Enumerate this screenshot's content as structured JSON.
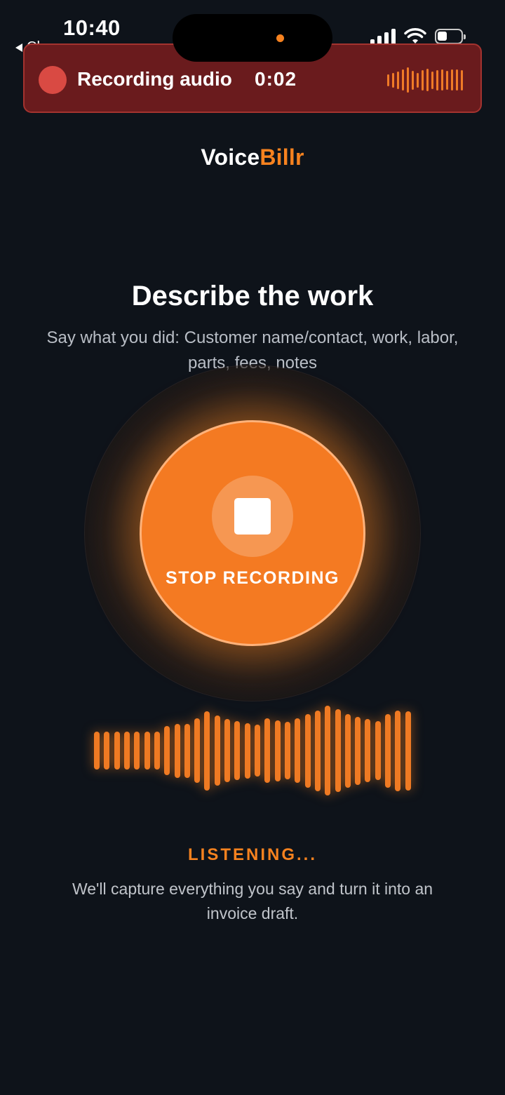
{
  "status_bar": {
    "time": "10:40",
    "back_app": "Chrome"
  },
  "recording_banner": {
    "label": "Recording audio",
    "timer": "0:02"
  },
  "brand": {
    "part1": "Voice",
    "part2": "Billr",
    "accent_color": "#f6821f"
  },
  "main": {
    "title": "Describe the work",
    "subtitle": "Say what you did: Customer name/contact, work, labor, parts, fees, notes",
    "record_button_label": "STOP RECORDING",
    "status": "LISTENING...",
    "description": "We'll capture everything you say and turn it into an invoice draft."
  },
  "icons": {
    "stop": "stop-icon",
    "record_indicator": "record-dot-icon",
    "signal": "cellular-signal-icon",
    "wifi": "wifi-icon",
    "battery": "battery-icon",
    "back": "back-arrow-icon"
  },
  "waveform_levels": [
    0.42,
    0.42,
    0.42,
    0.42,
    0.42,
    0.42,
    0.42,
    0.55,
    0.6,
    0.6,
    0.72,
    0.88,
    0.78,
    0.7,
    0.66,
    0.62,
    0.58,
    0.72,
    0.68,
    0.64,
    0.72,
    0.82,
    0.9,
    1.0,
    0.92,
    0.82,
    0.76,
    0.7,
    0.66,
    0.82,
    0.9,
    0.88
  ],
  "banner_wave_levels": [
    0.45,
    0.55,
    0.65,
    0.8,
    0.95,
    0.7,
    0.55,
    0.75,
    0.85,
    0.65,
    0.75,
    0.8,
    0.7,
    0.8,
    0.8,
    0.75
  ]
}
